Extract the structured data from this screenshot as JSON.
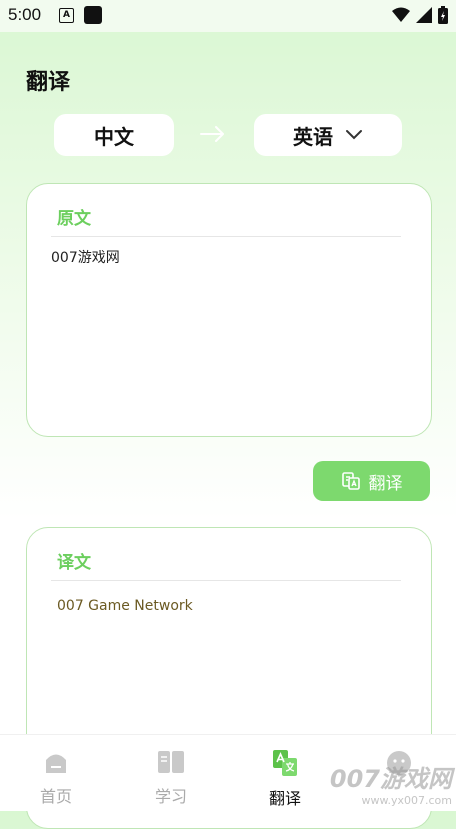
{
  "status_bar": {
    "time": "5:00",
    "a_icon_letter": "A"
  },
  "page": {
    "title": "翻译"
  },
  "lang": {
    "source": "中文",
    "target": "英语"
  },
  "source_card": {
    "label": "原文",
    "text": "007游戏网"
  },
  "translate_button": {
    "label": "翻译"
  },
  "result_card": {
    "label": "译文",
    "text": "007 Game Network"
  },
  "nav": {
    "items": [
      {
        "label": "首页",
        "icon": "home-icon"
      },
      {
        "label": "学习",
        "icon": "book-icon"
      },
      {
        "label": "翻译",
        "icon": "translate-icon",
        "active": true
      },
      {
        "label": "",
        "icon": "profile-icon"
      }
    ]
  },
  "watermark": {
    "main": "007游戏网",
    "sub": "www.yx007.com"
  },
  "colors": {
    "accent": "#7dd96e",
    "label_green": "#6ccf5e",
    "result_text": "#6b5a23"
  }
}
